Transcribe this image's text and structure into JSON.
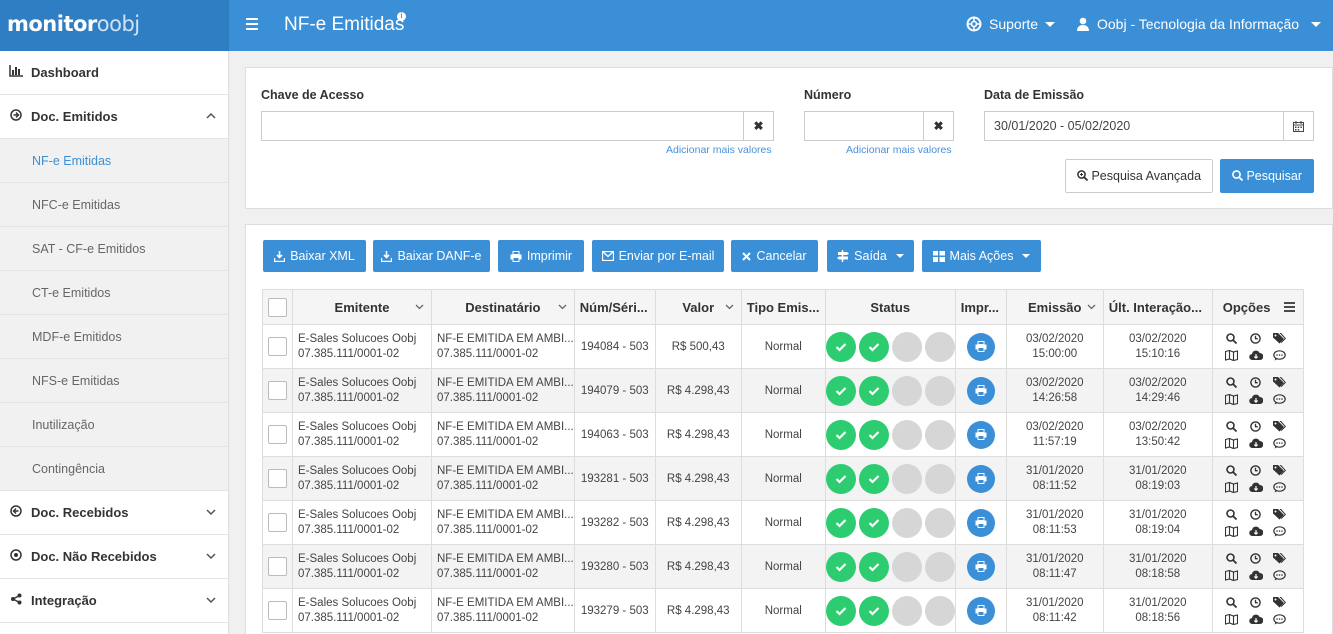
{
  "header": {
    "logo_main": "monitor",
    "logo_suffix": "oobj",
    "title": "NF-e Emitidas",
    "support_label": "Suporte",
    "user_label": "Oobj - Tecnologia da Informação"
  },
  "sidebar": {
    "dashboard": "Dashboard",
    "doc_emitidos": "Doc. Emitidos",
    "sub": [
      "NF-e Emitidas",
      "NFC-e Emitidas",
      "SAT - CF-e Emitidos",
      "CT-e Emitidos",
      "MDF-e Emitidos",
      "NFS-e Emitidas",
      "Inutilização",
      "Contingência"
    ],
    "doc_recebidos": "Doc. Recebidos",
    "doc_nao_recebidos": "Doc. Não Recebidos",
    "integracao": "Integração"
  },
  "search": {
    "chave_label": "Chave de Acesso",
    "chave_value": "",
    "numero_label": "Número",
    "numero_value": "",
    "data_label": "Data de Emissão",
    "data_value": "30/01/2020 - 05/02/2020",
    "add_more": "Adicionar mais valores",
    "adv_button": "Pesquisa Avançada",
    "search_button": "Pesquisar"
  },
  "actions": {
    "xml": "Baixar XML",
    "danfe": "Baixar DANF-e",
    "imprimir": "Imprimir",
    "email": "Enviar por E-mail",
    "cancelar": "Cancelar",
    "saida": "Saída",
    "mais": "Mais Ações"
  },
  "table": {
    "headers": {
      "emitente": "Emitente",
      "destinatario": "Destinatário",
      "numserie": "Núm/Séri...",
      "valor": "Valor",
      "tipo": "Tipo Emis...",
      "status": "Status",
      "impr": "Impr...",
      "emissao": "Emissão",
      "ult": "Últ. Interação...",
      "opcoes": "Opções"
    },
    "rows": [
      {
        "emitente": "E-Sales Solucoes Oobj",
        "emitente_cnpj": "07.385.111/0001-02",
        "dest": "NF-E EMITIDA EM AMBI...",
        "dest_cnpj": "07.385.111/0001-02",
        "num": "194084 - 503",
        "valor": "R$ 500,43",
        "tipo": "Normal",
        "emissao_d": "03/02/2020",
        "emissao_t": "15:00:00",
        "ult_d": "03/02/2020",
        "ult_t": "15:10:16"
      },
      {
        "emitente": "E-Sales Solucoes Oobj",
        "emitente_cnpj": "07.385.111/0001-02",
        "dest": "NF-E EMITIDA EM AMBI...",
        "dest_cnpj": "07.385.111/0001-02",
        "num": "194079 - 503",
        "valor": "R$ 4.298,43",
        "tipo": "Normal",
        "emissao_d": "03/02/2020",
        "emissao_t": "14:26:58",
        "ult_d": "03/02/2020",
        "ult_t": "14:29:46"
      },
      {
        "emitente": "E-Sales Solucoes Oobj",
        "emitente_cnpj": "07.385.111/0001-02",
        "dest": "NF-E EMITIDA EM AMBI...",
        "dest_cnpj": "07.385.111/0001-02",
        "num": "194063 - 503",
        "valor": "R$ 4.298,43",
        "tipo": "Normal",
        "emissao_d": "03/02/2020",
        "emissao_t": "11:57:19",
        "ult_d": "03/02/2020",
        "ult_t": "13:50:42"
      },
      {
        "emitente": "E-Sales Solucoes Oobj",
        "emitente_cnpj": "07.385.111/0001-02",
        "dest": "NF-E EMITIDA EM AMBI...",
        "dest_cnpj": "07.385.111/0001-02",
        "num": "193281 - 503",
        "valor": "R$ 4.298,43",
        "tipo": "Normal",
        "emissao_d": "31/01/2020",
        "emissao_t": "08:11:52",
        "ult_d": "31/01/2020",
        "ult_t": "08:19:03"
      },
      {
        "emitente": "E-Sales Solucoes Oobj",
        "emitente_cnpj": "07.385.111/0001-02",
        "dest": "NF-E EMITIDA EM AMBI...",
        "dest_cnpj": "07.385.111/0001-02",
        "num": "193282 - 503",
        "valor": "R$ 4.298,43",
        "tipo": "Normal",
        "emissao_d": "31/01/2020",
        "emissao_t": "08:11:53",
        "ult_d": "31/01/2020",
        "ult_t": "08:19:04"
      },
      {
        "emitente": "E-Sales Solucoes Oobj",
        "emitente_cnpj": "07.385.111/0001-02",
        "dest": "NF-E EMITIDA EM AMBI...",
        "dest_cnpj": "07.385.111/0001-02",
        "num": "193280 - 503",
        "valor": "R$ 4.298,43",
        "tipo": "Normal",
        "emissao_d": "31/01/2020",
        "emissao_t": "08:11:47",
        "ult_d": "31/01/2020",
        "ult_t": "08:18:58"
      },
      {
        "emitente": "E-Sales Solucoes Oobj",
        "emitente_cnpj": "07.385.111/0001-02",
        "dest": "NF-E EMITIDA EM AMBI...",
        "dest_cnpj": "07.385.111/0001-02",
        "num": "193279 - 503",
        "valor": "R$ 4.298,43",
        "tipo": "Normal",
        "emissao_d": "31/01/2020",
        "emissao_t": "08:11:42",
        "ult_d": "31/01/2020",
        "ult_t": "08:18:56"
      }
    ]
  },
  "colors": {
    "primary": "#3b8fd6",
    "status_ok": "#2ecc71",
    "status_off": "#d6d6d6"
  }
}
